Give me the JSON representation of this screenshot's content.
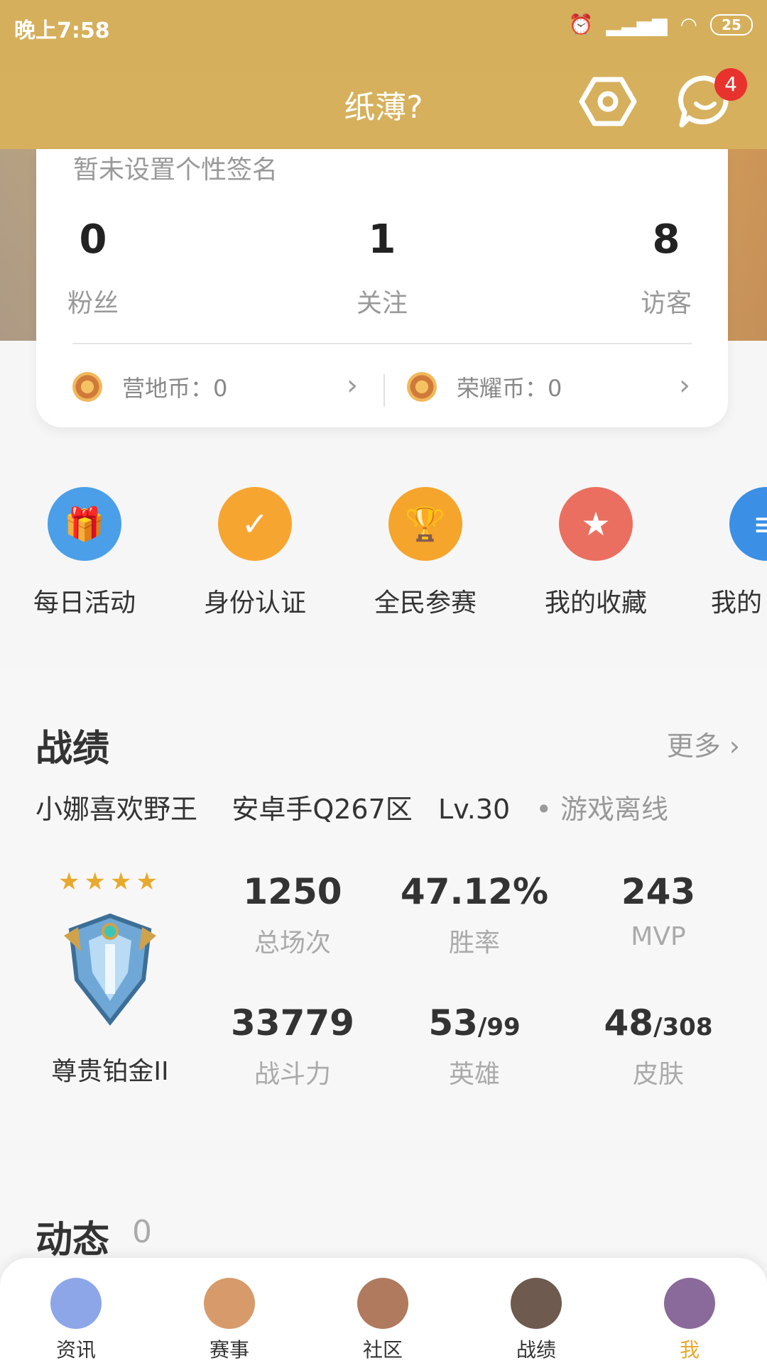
{
  "status_bar": {
    "time": "晚上7:58",
    "battery": "25"
  },
  "header": {
    "title": "纸薄?",
    "message_badge": "4"
  },
  "profile": {
    "signature": "暂未设置个性签名",
    "stats": [
      {
        "value": "0",
        "label": "粉丝"
      },
      {
        "value": "1",
        "label": "关注"
      },
      {
        "value": "8",
        "label": "访客"
      }
    ],
    "coins": [
      {
        "label": "营地币：0"
      },
      {
        "label": "荣耀币：0"
      }
    ]
  },
  "quick_actions": [
    {
      "label": "每日活动",
      "icon": "gift-icon",
      "color": "#4a9fe8"
    },
    {
      "label": "身份认证",
      "icon": "badge-check-icon",
      "color": "#f7a531"
    },
    {
      "label": "全民参赛",
      "icon": "trophy-icon",
      "color": "#f5a52c"
    },
    {
      "label": "我的收藏",
      "icon": "bookmark-star-icon",
      "color": "#ea6f60"
    },
    {
      "label": "我的",
      "icon": "document-icon",
      "color": "#3b8fe5"
    }
  ],
  "record": {
    "title": "战绩",
    "more_label": "更多 ›",
    "player_name": "小娜喜欢野王",
    "server": "安卓手Q267区",
    "level": "Lv.30",
    "status": "• 游戏离线",
    "rank_name": "尊贵铂金II",
    "rank_stars": "★★★★",
    "stats": [
      {
        "value": "1250",
        "label": "总场次"
      },
      {
        "value": "47.12%",
        "label": "胜率"
      },
      {
        "value": "243",
        "label": "MVP"
      },
      {
        "value": "33779",
        "label": "战斗力"
      },
      {
        "value": "53",
        "sub": "/99",
        "label": "英雄"
      },
      {
        "value": "48",
        "sub": "/308",
        "label": "皮肤"
      }
    ]
  },
  "feed": {
    "title": "动态",
    "count": "0"
  },
  "tabs": [
    {
      "label": "资讯",
      "color": "#8da6e8"
    },
    {
      "label": "赛事",
      "color": "#d79a6a"
    },
    {
      "label": "社区",
      "color": "#b07a5e"
    },
    {
      "label": "战绩",
      "color": "#6e5a4e"
    },
    {
      "label": "我",
      "color": "#8a6a9a",
      "active": true
    }
  ]
}
